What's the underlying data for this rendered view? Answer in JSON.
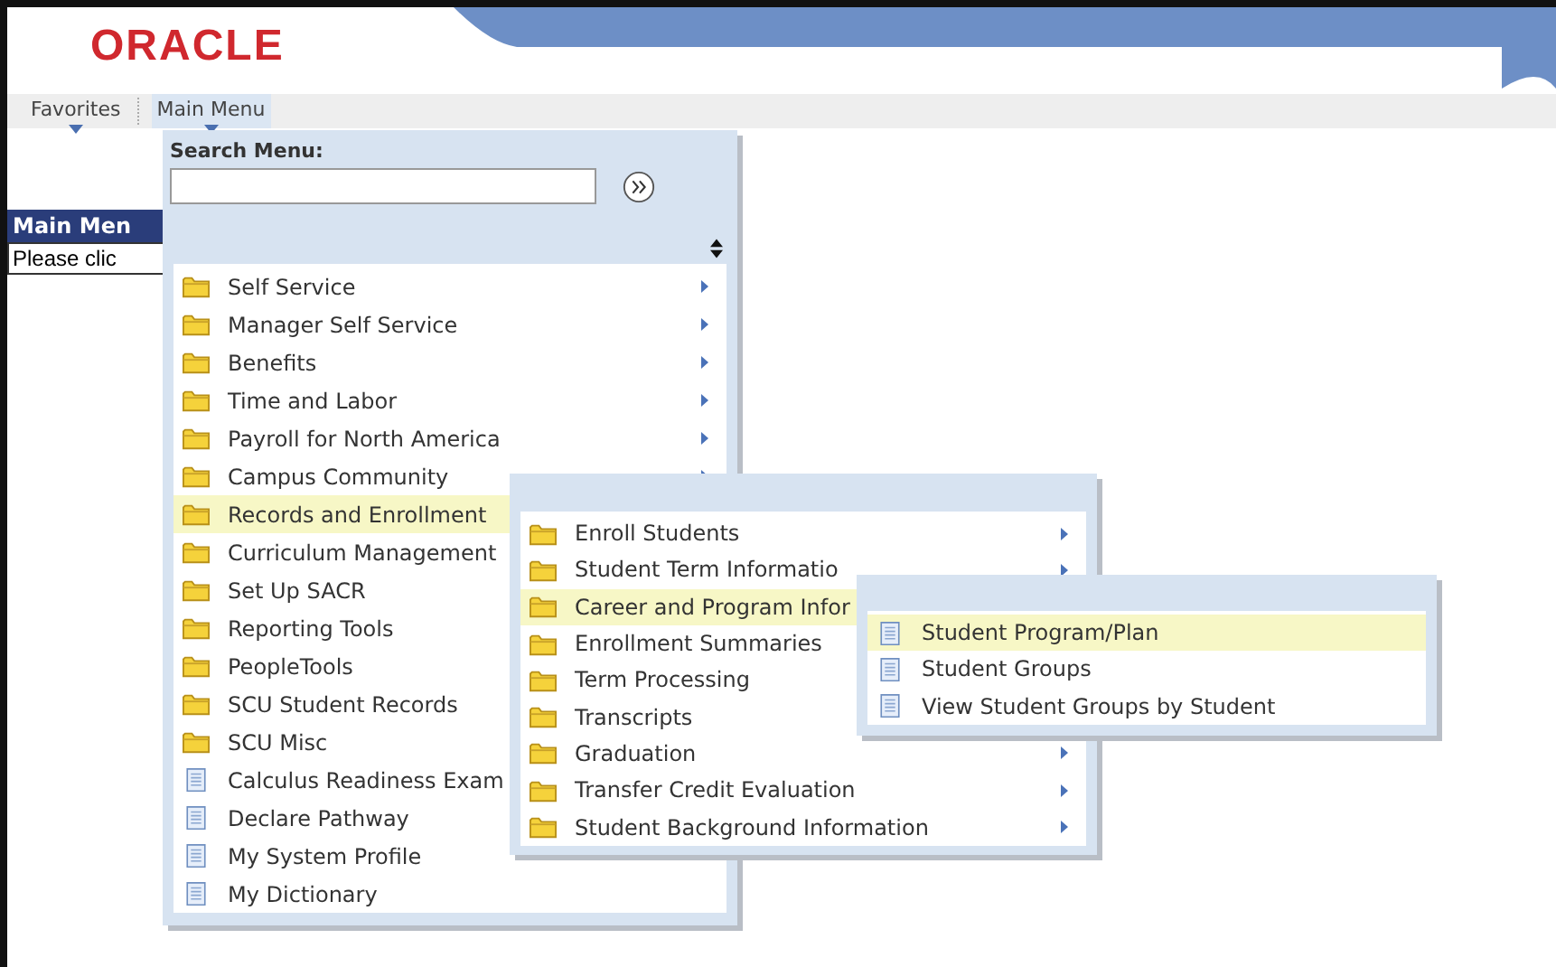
{
  "header": {
    "logo": "ORACLE"
  },
  "nav": [
    {
      "label": "Favorites",
      "selected": false
    },
    {
      "label": "Main Menu",
      "selected": true
    }
  ],
  "background": {
    "heading": "Main Men",
    "text": "Please clic"
  },
  "main_menu": {
    "search_label": "Search Menu:",
    "items": [
      {
        "label": "Self Service",
        "kind": "folder",
        "selected": false,
        "arrow": true
      },
      {
        "label": "Manager Self Service",
        "kind": "folder",
        "selected": false,
        "arrow": true
      },
      {
        "label": "Benefits",
        "kind": "folder",
        "selected": false,
        "arrow": true
      },
      {
        "label": "Time and Labor",
        "kind": "folder",
        "selected": false,
        "arrow": true
      },
      {
        "label": "Payroll for North America",
        "kind": "folder",
        "selected": false,
        "arrow": true
      },
      {
        "label": "Campus Community",
        "kind": "folder",
        "selected": false,
        "arrow": true
      },
      {
        "label": "Records and Enrollment",
        "kind": "folder",
        "selected": true
      },
      {
        "label": "Curriculum Management",
        "kind": "folder",
        "selected": false
      },
      {
        "label": "Set Up SACR",
        "kind": "folder",
        "selected": false
      },
      {
        "label": "Reporting Tools",
        "kind": "folder",
        "selected": false
      },
      {
        "label": "PeopleTools",
        "kind": "folder",
        "selected": false
      },
      {
        "label": "SCU Student Records",
        "kind": "folder",
        "selected": false
      },
      {
        "label": "SCU Misc",
        "kind": "folder",
        "selected": false
      },
      {
        "label": "Calculus Readiness Exam",
        "kind": "page",
        "selected": false
      },
      {
        "label": "Declare Pathway",
        "kind": "page",
        "selected": false
      },
      {
        "label": "My System Profile",
        "kind": "page",
        "selected": false
      },
      {
        "label": "My Dictionary",
        "kind": "page",
        "selected": false
      }
    ]
  },
  "submenu": {
    "items": [
      {
        "label": "Enroll Students",
        "kind": "folder",
        "selected": false,
        "arrow": true
      },
      {
        "label": "Student Term Informatio",
        "kind": "folder",
        "selected": false,
        "arrow": true
      },
      {
        "label": "Career and Program Infor",
        "kind": "folder",
        "selected": true
      },
      {
        "label": "Enrollment Summaries",
        "kind": "folder",
        "selected": false
      },
      {
        "label": "Term Processing",
        "kind": "folder",
        "selected": false
      },
      {
        "label": "Transcripts",
        "kind": "folder",
        "selected": false
      },
      {
        "label": "Graduation",
        "kind": "folder",
        "selected": false,
        "arrow": true
      },
      {
        "label": "Transfer Credit Evaluation",
        "kind": "folder",
        "selected": false,
        "arrow": true
      },
      {
        "label": "Student Background Information",
        "kind": "folder",
        "selected": false,
        "arrow": true
      }
    ]
  },
  "submenu_2": {
    "items": [
      {
        "label": "Student Program/Plan",
        "kind": "page",
        "selected": true
      },
      {
        "label": "Student Groups",
        "kind": "page",
        "selected": false
      },
      {
        "label": "View Student Groups by Student",
        "kind": "page",
        "selected": false
      }
    ]
  }
}
